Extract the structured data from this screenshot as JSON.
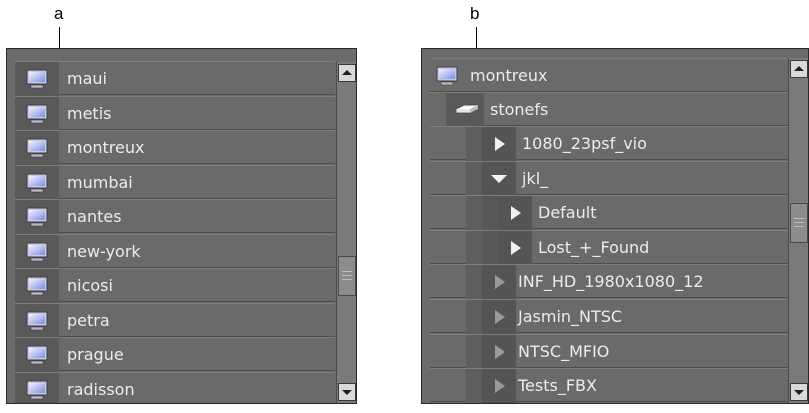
{
  "callouts": {
    "a": "a",
    "b": "b"
  },
  "left_panel": {
    "items": [
      {
        "label": "maui"
      },
      {
        "label": "metis"
      },
      {
        "label": "montreux"
      },
      {
        "label": "mumbai"
      },
      {
        "label": "nantes"
      },
      {
        "label": "new-york"
      },
      {
        "label": "nicosi"
      },
      {
        "label": "petra"
      },
      {
        "label": "prague"
      },
      {
        "label": "radisson"
      }
    ]
  },
  "right_panel": {
    "host": "montreux",
    "volume": "stonefs",
    "folders": [
      {
        "label": "1080_23psf_vio",
        "state": "collapsed",
        "level": 1
      },
      {
        "label": "jkl_",
        "state": "expanded",
        "level": 1
      },
      {
        "label": "Default",
        "state": "collapsed",
        "level": 2
      },
      {
        "label": "Lost_+_Found",
        "state": "collapsed",
        "level": 2
      },
      {
        "label": "INF_HD_1980x1080_12",
        "state": "collapsed-dim",
        "level": 1
      },
      {
        "label": "Jasmin_NTSC",
        "state": "collapsed-dim",
        "level": 1
      },
      {
        "label": "NTSC_MFIO",
        "state": "collapsed-dim",
        "level": 1
      },
      {
        "label": "Tests_FBX",
        "state": "collapsed-dim",
        "level": 1
      }
    ]
  },
  "colors": {
    "panel_bg": "#6a6a6a",
    "text": "#ececec",
    "icon_column": "#595959",
    "scroll_track": "#7a7a7a"
  },
  "icons": {
    "host": "computer-monitor-icon",
    "volume": "disk-drive-icon",
    "expand": "triangle-right-icon",
    "collapse": "triangle-down-icon"
  }
}
